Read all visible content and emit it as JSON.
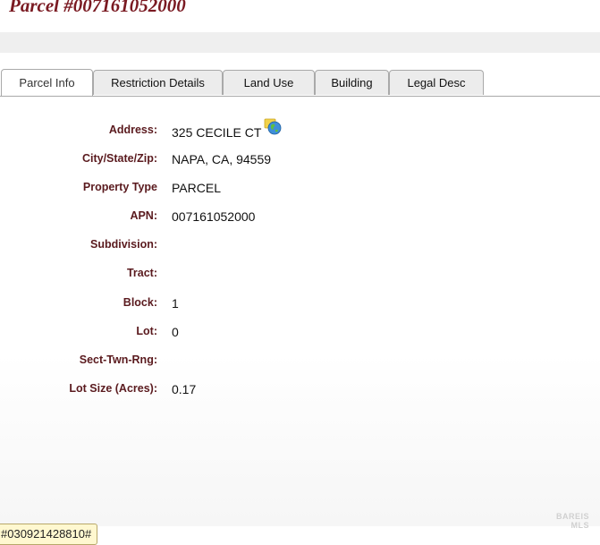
{
  "page": {
    "title": "Parcel #007161052000"
  },
  "tabs": [
    {
      "label": "Parcel Info",
      "active": true
    },
    {
      "label": "Restriction Details",
      "active": false
    },
    {
      "label": "Land Use",
      "active": false
    },
    {
      "label": "Building",
      "active": false
    },
    {
      "label": "Legal Desc",
      "active": false
    }
  ],
  "fields": {
    "address": {
      "label": "Address:",
      "value": "325 CECILE CT"
    },
    "city_state_zip": {
      "label": "City/State/Zip:",
      "value": "NAPA, CA, 94559"
    },
    "property_type": {
      "label": "Property Type",
      "value": "PARCEL"
    },
    "apn": {
      "label": "APN:",
      "value": "007161052000"
    },
    "subdivision": {
      "label": "Subdivision:",
      "value": ""
    },
    "tract": {
      "label": "Tract:",
      "value": ""
    },
    "block": {
      "label": "Block:",
      "value": "1"
    },
    "lot": {
      "label": "Lot:",
      "value": "0"
    },
    "sect_twn_rng": {
      "label": "Sect-Twn-Rng:",
      "value": ""
    },
    "lot_size": {
      "label": "Lot Size (Acres):",
      "value": "0.17"
    }
  },
  "address_icon": "globe-icon",
  "status_chip": "#030921428810#",
  "watermark": {
    "line1": "BAREIS",
    "line2": "MLS"
  },
  "colors": {
    "title": "#7a1a22",
    "label": "#5a1a1e",
    "tab_border": "#a9a9a9"
  }
}
